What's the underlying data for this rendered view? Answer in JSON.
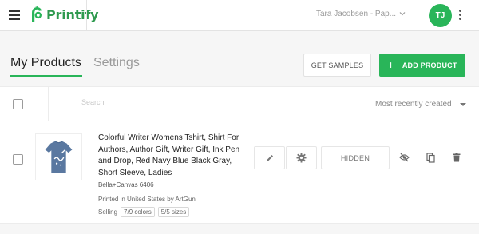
{
  "header": {
    "app_name": "Printify",
    "store_name": "Tara Jacobsen - Pap...",
    "avatar_initials": "TJ",
    "brand_color": "#29b559"
  },
  "tabs": [
    {
      "label": "My Products",
      "active": true
    },
    {
      "label": "Settings",
      "active": false
    }
  ],
  "actions": {
    "get_samples_label": "GET SAMPLES",
    "add_product_label": "ADD PRODUCT"
  },
  "table": {
    "search_placeholder": "Search",
    "sort_value": "Most recently created"
  },
  "products": [
    {
      "title": "Colorful Writer Womens Tshirt, Shirt For Authors, Author Gift, Writer Gift, Ink Pen and Drop, Red Navy Blue Black Gray, Short Sleeve, Ladies",
      "model": "Bella+Canvas 6406",
      "printed_by": "Printed in United States by ArtGun",
      "selling_label": "Selling",
      "colors": "7/9 colors",
      "sizes": "5/5 sizes",
      "visibility_label": "HIDDEN",
      "icons": [
        "pencil-icon",
        "gear-icon",
        "eye-off-icon",
        "copy-icon",
        "trash-icon"
      ]
    }
  ]
}
